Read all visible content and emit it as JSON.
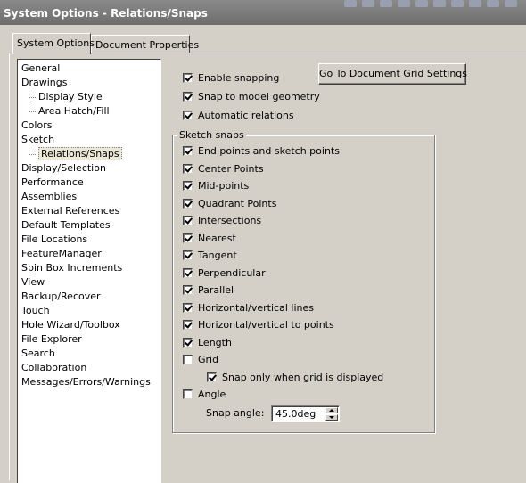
{
  "window": {
    "title": "System Options - Relations/Snaps"
  },
  "tabs": [
    {
      "label": "System Options"
    },
    {
      "label": "Document Properties"
    }
  ],
  "nav": {
    "items": [
      {
        "label": "General",
        "level": 0
      },
      {
        "label": "Drawings",
        "level": 0
      },
      {
        "label": "Display Style",
        "level": 1
      },
      {
        "label": "Area Hatch/Fill",
        "level": 1
      },
      {
        "label": "Colors",
        "level": 0
      },
      {
        "label": "Sketch",
        "level": 0
      },
      {
        "label": "Relations/Snaps",
        "level": 1,
        "selected": true
      },
      {
        "label": "Display/Selection",
        "level": 0
      },
      {
        "label": "Performance",
        "level": 0
      },
      {
        "label": "Assemblies",
        "level": 0
      },
      {
        "label": "External References",
        "level": 0
      },
      {
        "label": "Default Templates",
        "level": 0
      },
      {
        "label": "File Locations",
        "level": 0
      },
      {
        "label": "FeatureManager",
        "level": 0
      },
      {
        "label": "Spin Box Increments",
        "level": 0
      },
      {
        "label": "View",
        "level": 0
      },
      {
        "label": "Backup/Recover",
        "level": 0
      },
      {
        "label": "Touch",
        "level": 0
      },
      {
        "label": "Hole Wizard/Toolbox",
        "level": 0
      },
      {
        "label": "File Explorer",
        "level": 0
      },
      {
        "label": "Search",
        "level": 0
      },
      {
        "label": "Collaboration",
        "level": 0
      },
      {
        "label": "Messages/Errors/Warnings",
        "level": 0
      }
    ]
  },
  "options": {
    "enable_snapping": {
      "label": "Enable snapping",
      "checked": true
    },
    "snap_model_geometry": {
      "label": "Snap to model geometry",
      "checked": true
    },
    "automatic_relations": {
      "label": "Automatic relations",
      "checked": true
    }
  },
  "grid_button": {
    "label": "Go To Document Grid Settings"
  },
  "sketch_snaps": {
    "title": "Sketch snaps",
    "items": [
      {
        "label": "End points and sketch points",
        "checked": true
      },
      {
        "label": "Center Points",
        "checked": true
      },
      {
        "label": "Mid-points",
        "checked": true
      },
      {
        "label": "Quadrant Points",
        "checked": true
      },
      {
        "label": "Intersections",
        "checked": true
      },
      {
        "label": "Nearest",
        "checked": true
      },
      {
        "label": "Tangent",
        "checked": true
      },
      {
        "label": "Perpendicular",
        "checked": true
      },
      {
        "label": "Parallel",
        "checked": true
      },
      {
        "label": "Horizontal/vertical lines",
        "checked": true
      },
      {
        "label": "Horizontal/vertical to points",
        "checked": true
      },
      {
        "label": "Length",
        "checked": true
      },
      {
        "label": "Grid",
        "checked": false
      },
      {
        "label": "Snap only when grid is displayed",
        "checked": true
      },
      {
        "label": "Angle",
        "checked": false
      }
    ],
    "snap_angle_label": "Snap angle:",
    "snap_angle_value": "45.0deg"
  }
}
